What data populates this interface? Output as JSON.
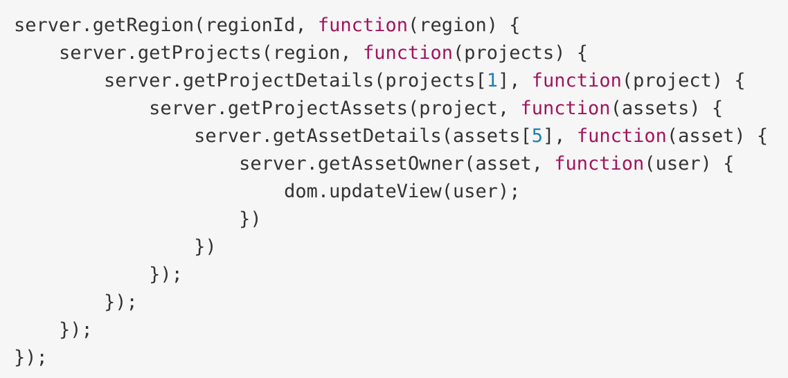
{
  "colors": {
    "background": "#f6f6f6",
    "text": "#333333",
    "keyword": "#a0155e",
    "number": "#1c7fb3"
  },
  "code": {
    "language": "javascript",
    "lines": [
      {
        "indent": "",
        "tokens": [
          {
            "t": "id",
            "v": "server.getRegion(regionId, "
          },
          {
            "t": "kw",
            "v": "function"
          },
          {
            "t": "id",
            "v": "(region) {"
          }
        ]
      },
      {
        "indent": "    ",
        "tokens": [
          {
            "t": "id",
            "v": "server.getProjects(region, "
          },
          {
            "t": "kw",
            "v": "function"
          },
          {
            "t": "id",
            "v": "(projects) {"
          }
        ]
      },
      {
        "indent": "        ",
        "tokens": [
          {
            "t": "id",
            "v": "server.getProjectDetails(projects["
          },
          {
            "t": "num",
            "v": "1"
          },
          {
            "t": "id",
            "v": "], "
          },
          {
            "t": "kw",
            "v": "function"
          },
          {
            "t": "id",
            "v": "(project) {"
          }
        ]
      },
      {
        "indent": "            ",
        "tokens": [
          {
            "t": "id",
            "v": "server.getProjectAssets(project, "
          },
          {
            "t": "kw",
            "v": "function"
          },
          {
            "t": "id",
            "v": "(assets) {"
          }
        ]
      },
      {
        "indent": "                ",
        "tokens": [
          {
            "t": "id",
            "v": "server.getAssetDetails(assets["
          },
          {
            "t": "num",
            "v": "5"
          },
          {
            "t": "id",
            "v": "], "
          },
          {
            "t": "kw",
            "v": "function"
          },
          {
            "t": "id",
            "v": "(asset) {"
          }
        ]
      },
      {
        "indent": "                    ",
        "tokens": [
          {
            "t": "id",
            "v": "server.getAssetOwner(asset, "
          },
          {
            "t": "kw",
            "v": "function"
          },
          {
            "t": "id",
            "v": "(user) {"
          }
        ]
      },
      {
        "indent": "                        ",
        "tokens": [
          {
            "t": "id",
            "v": "dom.updateView(user);"
          }
        ]
      },
      {
        "indent": "                    ",
        "tokens": [
          {
            "t": "pun",
            "v": "})"
          }
        ]
      },
      {
        "indent": "                ",
        "tokens": [
          {
            "t": "pun",
            "v": "})"
          }
        ]
      },
      {
        "indent": "            ",
        "tokens": [
          {
            "t": "pun",
            "v": "});"
          }
        ]
      },
      {
        "indent": "        ",
        "tokens": [
          {
            "t": "pun",
            "v": "});"
          }
        ]
      },
      {
        "indent": "    ",
        "tokens": [
          {
            "t": "pun",
            "v": "});"
          }
        ]
      },
      {
        "indent": "",
        "tokens": [
          {
            "t": "pun",
            "v": "});"
          }
        ]
      }
    ]
  }
}
